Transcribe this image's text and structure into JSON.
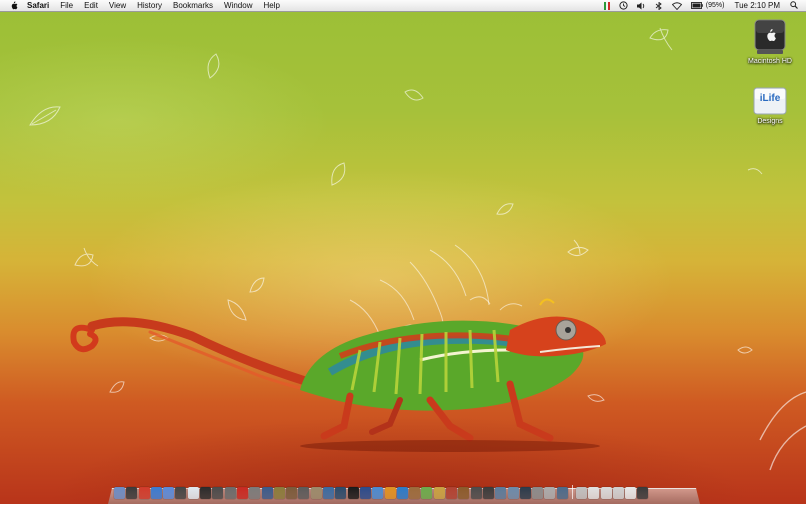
{
  "menubar": {
    "apple_icon": "apple-logo-icon",
    "app_name": "Safari",
    "menus": [
      "File",
      "Edit",
      "View",
      "History",
      "Bookmarks",
      "Window",
      "Help"
    ],
    "status": {
      "icons": [
        "flag-icon",
        "time-machine-icon",
        "volume-icon",
        "bluetooth-icon",
        "wifi-icon",
        "battery-icon"
      ],
      "battery_percent": "(95%)",
      "clock": "Tue 2:10 PM",
      "spotlight_icon": "spotlight-search-icon"
    }
  },
  "desktop": {
    "icons": [
      {
        "label": "Macintosh HD",
        "icon": "hard-drive-icon"
      },
      {
        "label": "Designs",
        "icon": "ilife-folder-icon",
        "badge": "iLife"
      }
    ],
    "wallpaper": "chameleon-wallpaper"
  },
  "dock": {
    "colors": [
      "#6b8cc4",
      "#3a3a3a",
      "#d03a2a",
      "#3a7ad0",
      "#5a8ad8",
      "#444444",
      "#dfe7ef",
      "#2a2a2a",
      "#4a4a4a",
      "#6a6a6a",
      "#c82820",
      "#7a7a7a",
      "#3a5a8a",
      "#8a7a3a",
      "#7a5a3a",
      "#5a5a5a",
      "#9a8a6a",
      "#3a6aa0",
      "#2a4a6a",
      "#1a1a1a",
      "#2a4a8a",
      "#4a8ad0",
      "#e09020",
      "#2a7ac8",
      "#9a6a3a",
      "#6aaa4a",
      "#c8a040",
      "#b04030",
      "#8a5a2a",
      "#4a4a4a",
      "#3a3a3a",
      "#5a7a9a",
      "#6a8aaa",
      "#2a3a4a",
      "#8a8a8a",
      "#aaaaaa",
      "#4a6a8a",
      "#c0c0c0",
      "#e0e0e0",
      "#d8d8d8",
      "#cfcfcf",
      "#e6e6e6",
      "#3a3a3a"
    ]
  }
}
